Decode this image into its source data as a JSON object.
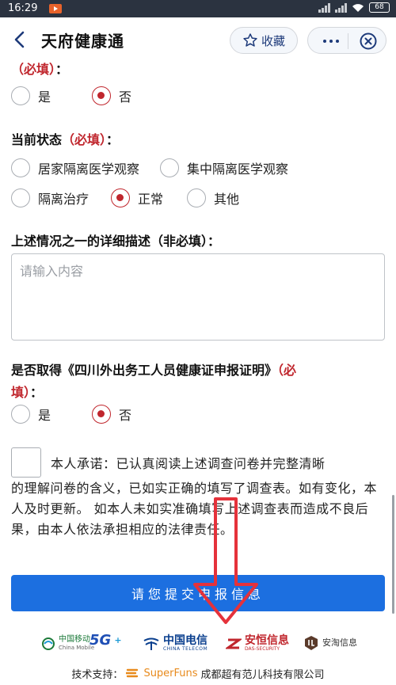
{
  "status_bar": {
    "time": "16:29",
    "battery": "68"
  },
  "header": {
    "title": "天府健康通",
    "favorite_label": "收藏"
  },
  "q_top": {
    "label_suffix": "：",
    "required": "（必填）",
    "options": [
      {
        "label": "是",
        "checked": false
      },
      {
        "label": "否",
        "checked": true
      }
    ]
  },
  "q_status": {
    "label": "当前状态",
    "required": "（必填）",
    "label_suffix": "：",
    "row1": [
      {
        "label": "居家隔离医学观察",
        "checked": false
      },
      {
        "label": "集中隔离医学观察",
        "checked": false
      }
    ],
    "row2": [
      {
        "label": "隔离治疗",
        "checked": false
      },
      {
        "label": "正常",
        "checked": true
      },
      {
        "label": "其他",
        "checked": false
      }
    ]
  },
  "q_detail": {
    "label": "上述情况之一的详细描述（非必填）：",
    "placeholder": "请输入内容"
  },
  "q_cert": {
    "label_line1": "是否取得《四川外出务工人员健康证申报证明》",
    "required_part1": "（必",
    "required_part2": "填）",
    "label_suffix": "：",
    "options": [
      {
        "label": "是",
        "checked": false
      },
      {
        "label": "否",
        "checked": true
      }
    ]
  },
  "pledge": {
    "first_line": "本人承诺：已认真阅读上述调查问卷并完整清晰",
    "rest": "的理解问卷的含义，已如实正确的填写了调查表。如有变化，本人及时更新。 如本人未如实准确填写上述调查表而造成不良后果，由本人依法承担相应的法律责任。"
  },
  "submit_label": "请您提交申报信息",
  "logos": {
    "china_mobile": "中国移动",
    "china_mobile_en": "China Mobile",
    "fiveg": "5G",
    "china_telecom": "中国电信",
    "china_telecom_en": "CHINA TELECOM",
    "anheng": "安恒信息",
    "anheng_en": "DAS-SECURITY",
    "antao": "安淘信息"
  },
  "footer": {
    "prefix": "技术支持：",
    "brand": "SuperFuns",
    "company": "成都超有范儿科技有限公司"
  },
  "colors": {
    "required": "#c0262d",
    "primary": "#1c6fe0",
    "arrow": "#e5323b"
  }
}
